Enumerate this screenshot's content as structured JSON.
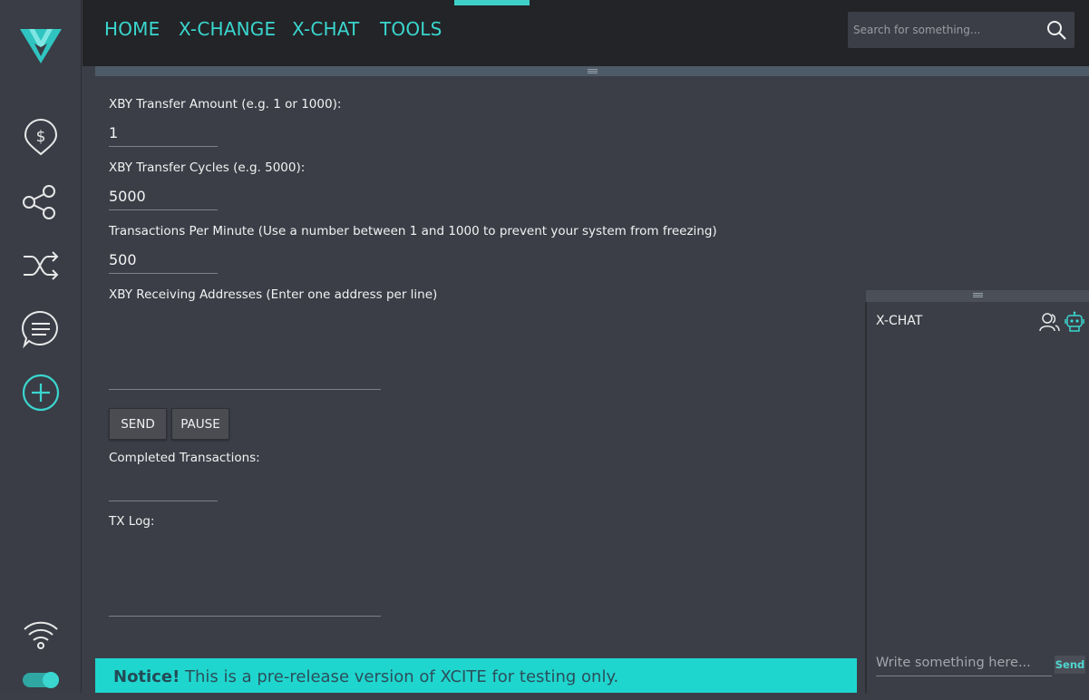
{
  "nav": {
    "items": [
      {
        "label": "HOME"
      },
      {
        "label": "X-CHANGE"
      },
      {
        "label": "X-CHAT"
      },
      {
        "label": "TOOLS"
      }
    ],
    "active": "TOOLS"
  },
  "search": {
    "placeholder": "Search for something..."
  },
  "sidebar": {
    "icons": [
      "logo",
      "dollar-pin-icon",
      "share-icon",
      "shuffle-icon",
      "chat-icon",
      "add-icon",
      "wifi-icon",
      "toggle-icon"
    ]
  },
  "form": {
    "amount_label": "XBY Transfer Amount (e.g. 1 or 1000):",
    "amount_value": "1",
    "cycles_label": "XBY Transfer Cycles (e.g. 5000):",
    "cycles_value": "5000",
    "tpm_label": "Transactions Per Minute (Use a number between 1 and 1000 to prevent your system from freezing)",
    "tpm_value": "500",
    "addresses_label": "XBY Receiving Addresses (Enter one address per line)",
    "send_label": "SEND",
    "pause_label": "PAUSE",
    "completed_label": "Completed Transactions:",
    "txlog_label": "TX Log:"
  },
  "notice": {
    "strong": "Notice!",
    "text": " This is a pre-release version of XCITE for testing only."
  },
  "chat": {
    "title": "X-CHAT",
    "placeholder": "Write something here...",
    "send_label": "Send"
  },
  "colors": {
    "accent": "#3ad6cf",
    "topbar": "#232427",
    "panel": "#3b3e47",
    "notice": "#1fd6cf"
  }
}
